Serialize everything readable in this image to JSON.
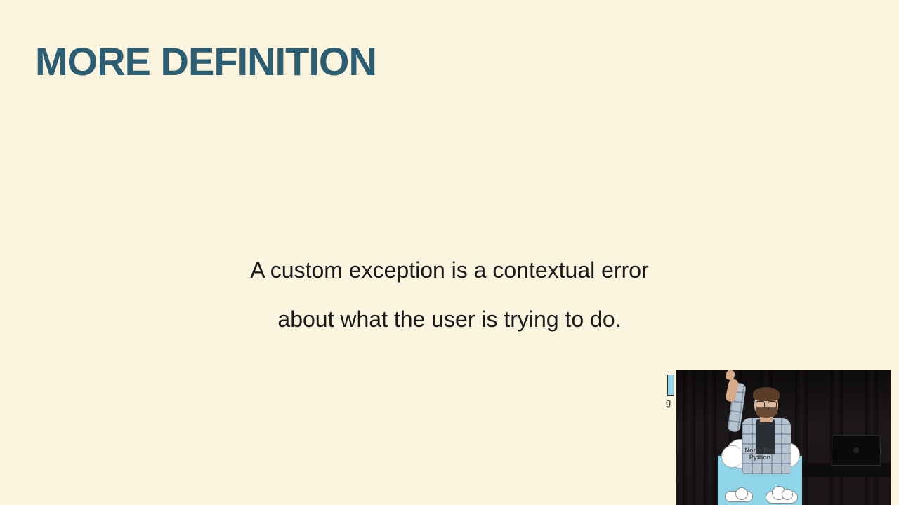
{
  "slide": {
    "title": "MORE DEFINITION",
    "body_line1": "A custom exception is a contextual error",
    "body_line2": "about what the user is trying to do."
  },
  "pip": {
    "sliver_char": "g",
    "podium_label_line1": "North Bay",
    "podium_label_line2": "Python"
  }
}
